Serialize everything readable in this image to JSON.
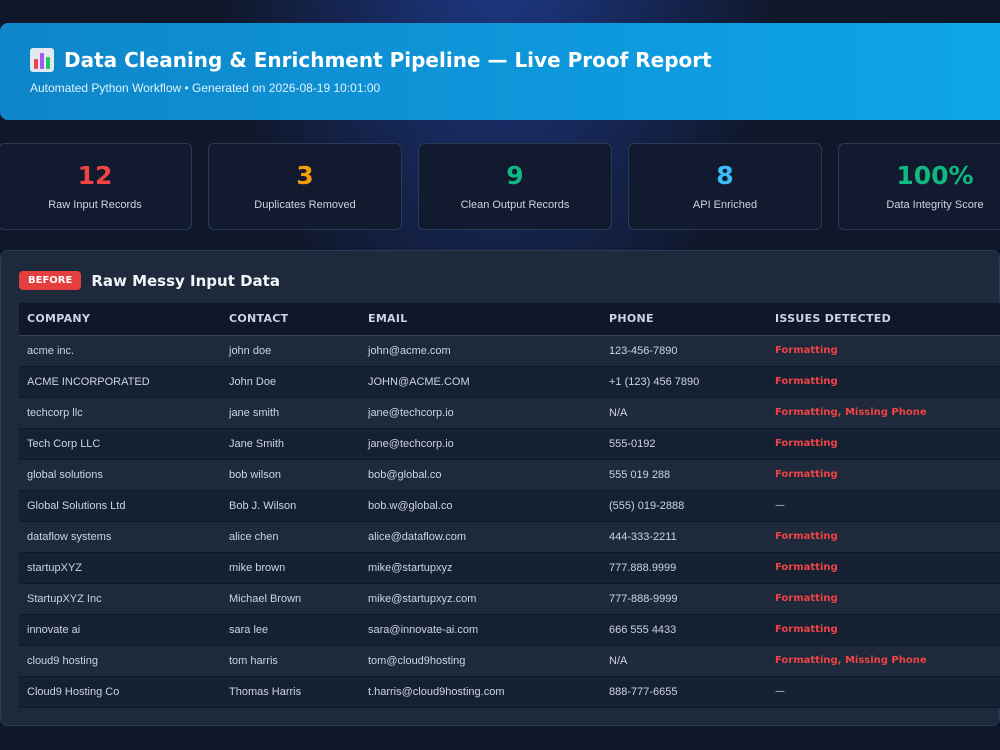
{
  "header": {
    "title": "Data Cleaning & Enrichment Pipeline — Live Proof Report",
    "subtitle": "Automated Python Workflow • Generated on 2026-08-19 10:01:00"
  },
  "stats": [
    {
      "value": "12",
      "label": "Raw Input Records",
      "color": "#ef4444"
    },
    {
      "value": "3",
      "label": "Duplicates Removed",
      "color": "#f59e0b"
    },
    {
      "value": "9",
      "label": "Clean Output Records",
      "color": "#10b981"
    },
    {
      "value": "8",
      "label": "API Enriched",
      "color": "#38bdf8"
    },
    {
      "value": "100%",
      "label": "Data Integrity Score",
      "color": "#10b981"
    }
  ],
  "panel": {
    "badge": "BEFORE",
    "title": "Raw Messy Input Data"
  },
  "table": {
    "columns": [
      "COMPANY",
      "CONTACT",
      "EMAIL",
      "PHONE",
      "ISSUES DETECTED"
    ],
    "rows": [
      [
        "acme inc.",
        "john doe",
        "john@acme.com",
        "123-456-7890",
        "Formatting"
      ],
      [
        "ACME INCORPORATED",
        "John Doe",
        "JOHN@ACME.COM",
        "+1 (123) 456 7890",
        "Formatting"
      ],
      [
        "techcorp llc",
        "jane smith",
        "jane@techcorp.io",
        "N/A",
        "Formatting, Missing Phone"
      ],
      [
        "Tech Corp LLC",
        "Jane Smith",
        "jane@techcorp.io",
        "555-0192",
        "Formatting"
      ],
      [
        "global solutions",
        "bob wilson",
        "bob@global.co",
        "555 019 288",
        "Formatting"
      ],
      [
        "Global Solutions Ltd",
        "Bob J. Wilson",
        "bob.w@global.co",
        "(555) 019-2888",
        "—"
      ],
      [
        "dataflow systems",
        "alice chen",
        "alice@dataflow.com",
        "444-333-2211",
        "Formatting"
      ],
      [
        "startupXYZ",
        "mike brown",
        "mike@startupxyz",
        "777.888.9999",
        "Formatting"
      ],
      [
        "StartupXYZ Inc",
        "Michael Brown",
        "mike@startupxyz.com",
        "777-888-9999",
        "Formatting"
      ],
      [
        "innovate ai",
        "sara lee",
        "sara@innovate-ai.com",
        "666 555 4433",
        "Formatting"
      ],
      [
        "cloud9 hosting",
        "tom harris",
        "tom@cloud9hosting",
        "N/A",
        "Formatting, Missing Phone"
      ],
      [
        "Cloud9 Hosting Co",
        "Thomas Harris",
        "t.harris@cloud9hosting.com",
        "888-777-6655",
        "—"
      ]
    ]
  }
}
